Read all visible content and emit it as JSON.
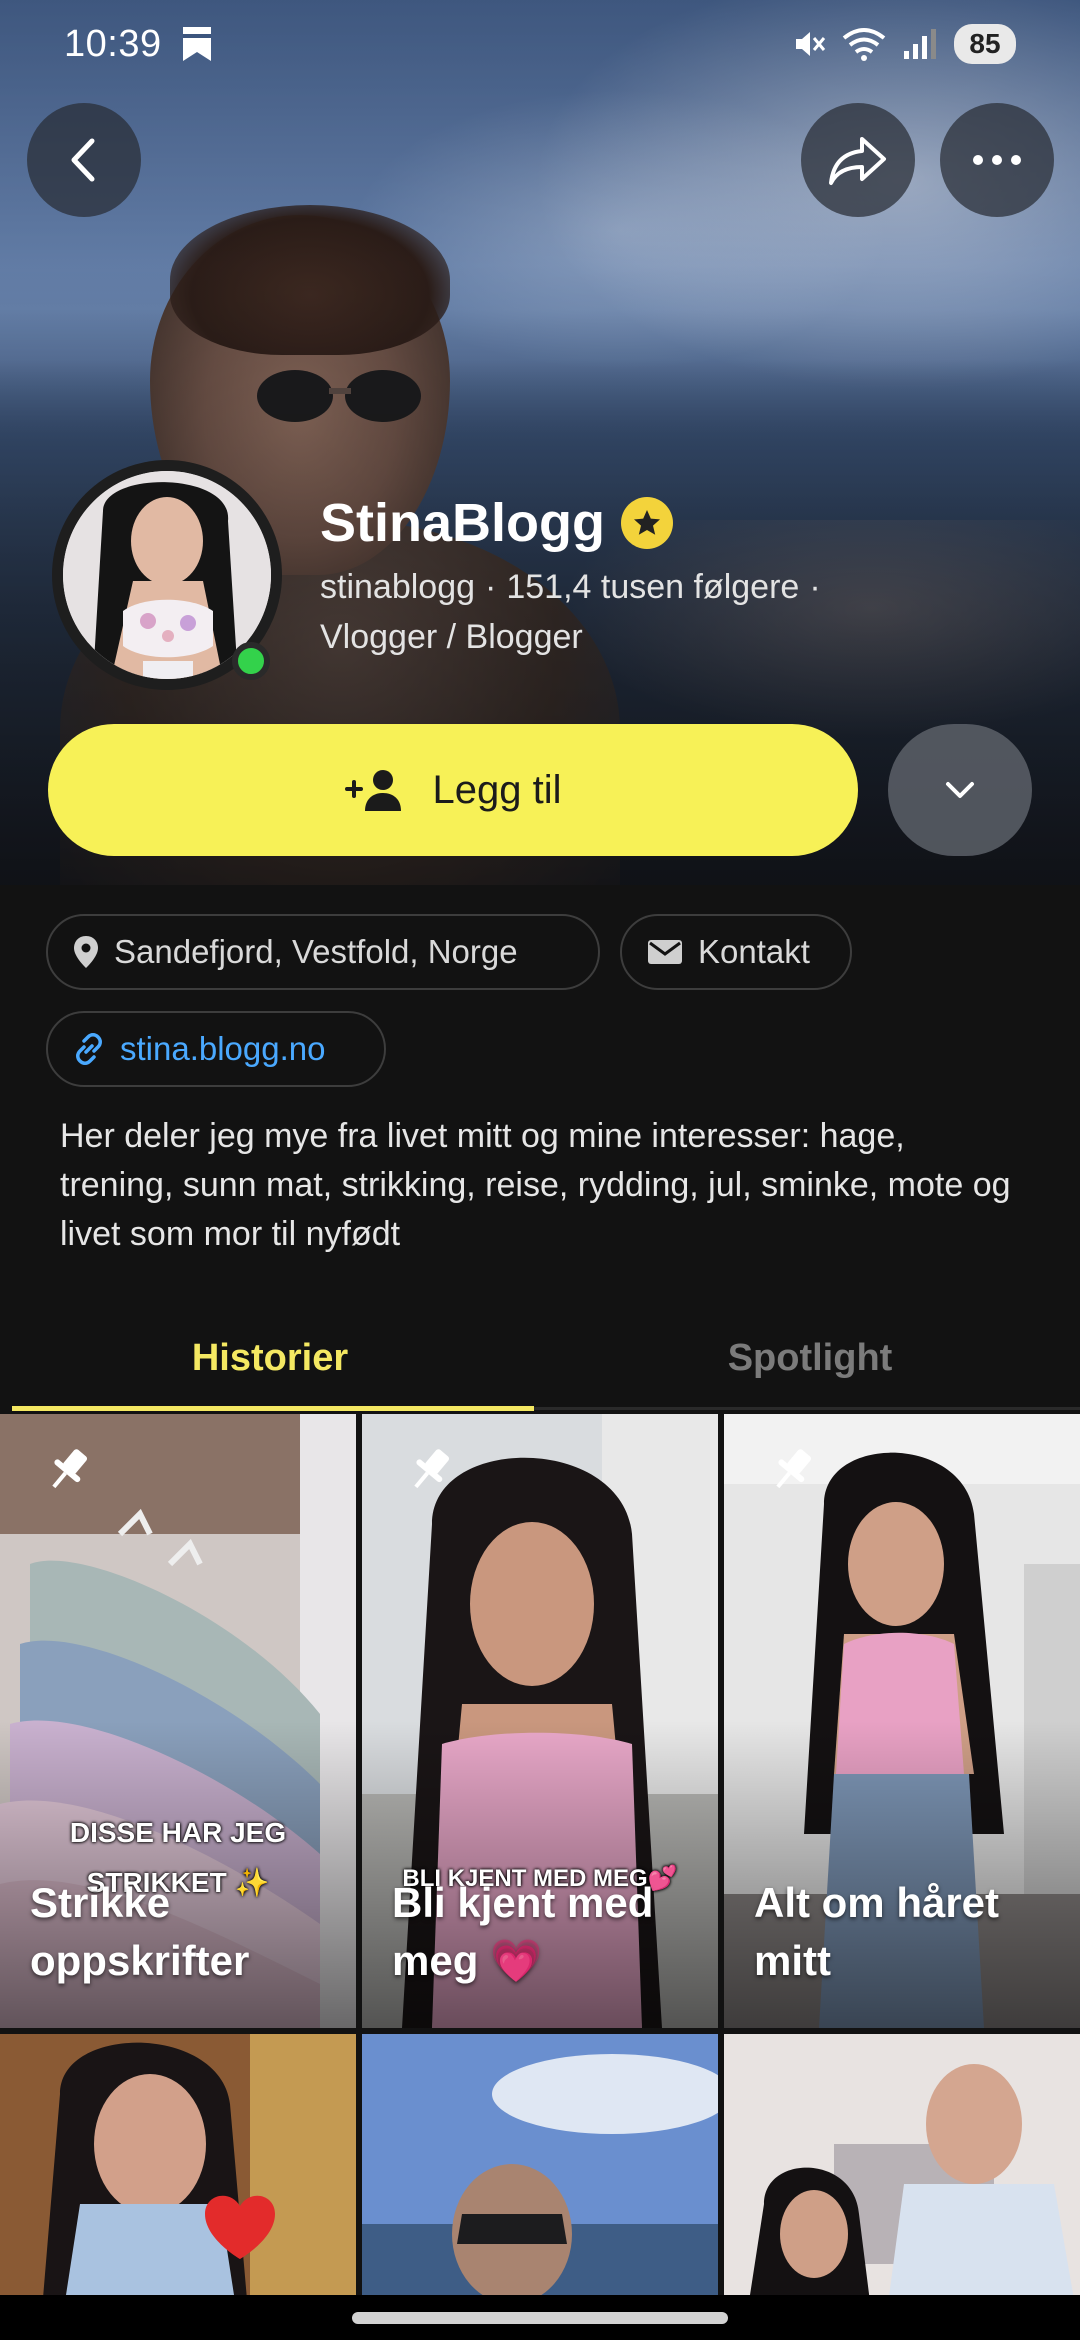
{
  "status_bar": {
    "time": "10:39",
    "battery": "85"
  },
  "header": {
    "back_icon": "chevron-left-icon",
    "share_icon": "share-arrow-icon",
    "more_icon": "more-horizontal-icon"
  },
  "profile": {
    "display_name": "StinaBlogg",
    "badge_icon": "star-badge-icon",
    "username": "stinablogg",
    "followers": "151,4 tusen følgere",
    "category": "Vlogger / Blogger",
    "online": true
  },
  "actions": {
    "add_label": "Legg til",
    "add_icon": "add-friend-icon",
    "expand_icon": "chevron-down-icon"
  },
  "info": {
    "location": "Sandefjord, Vestfold, Norge",
    "contact": "Kontakt",
    "website": "stina.blogg.no",
    "bio": "Her deler jeg mye fra livet mitt og mine interesser: hage, trening, sunn mat, strikking, reise, rydding, jul, sminke, mote og livet som mor til nyfødt"
  },
  "tabs": [
    {
      "label": "Historier",
      "active": true
    },
    {
      "label": "Spotlight",
      "active": false
    }
  ],
  "highlights": [
    {
      "title": "Strikke oppskrifter",
      "pinned": true,
      "overlay": "DISSE HAR JEG STRIKKET ✨"
    },
    {
      "title": "Bli kjent med meg 💗",
      "pinned": true,
      "overlay": "BLI KJENT MED MEG💕"
    },
    {
      "title": "Alt om håret mitt",
      "pinned": true,
      "overlay": ""
    }
  ],
  "colors": {
    "accent_yellow": "#F7F157",
    "tab_active": "#F4E862",
    "link_blue": "#4AA9FF",
    "online_green": "#33D24B",
    "background": "#121212"
  }
}
